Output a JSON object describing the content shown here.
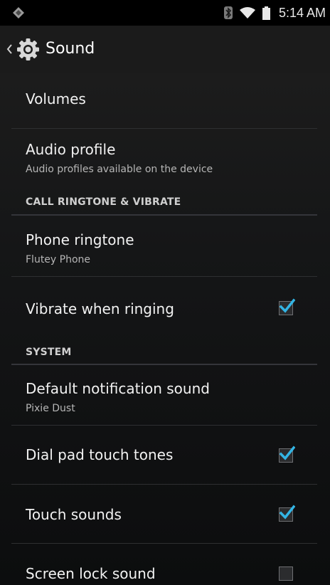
{
  "status_bar": {
    "time": "5:14 AM",
    "icons": [
      "app-notification-icon",
      "bluetooth-icon",
      "wifi-icon",
      "battery-icon"
    ]
  },
  "action_bar": {
    "title": "Sound",
    "icons": [
      "chevron-left-icon",
      "settings-gear-icon"
    ]
  },
  "items": {
    "volumes": {
      "title": "Volumes"
    },
    "audio_profile": {
      "title": "Audio profile",
      "summary": "Audio profiles available on the device"
    },
    "phone_ringtone": {
      "title": "Phone ringtone",
      "summary": "Flutey Phone"
    },
    "vibrate_when_ringing": {
      "title": "Vibrate when ringing",
      "checked": true
    },
    "default_notification_sound": {
      "title": "Default notification sound",
      "summary": "Pixie Dust"
    },
    "dial_pad_touch_tones": {
      "title": "Dial pad touch tones",
      "checked": true
    },
    "touch_sounds": {
      "title": "Touch sounds",
      "checked": true
    },
    "screen_lock_sound": {
      "title": "Screen lock sound",
      "checked": false
    }
  },
  "sections": {
    "call": "CALL RINGTONE & VIBRATE",
    "system": "SYSTEM"
  },
  "colors": {
    "accent": "#33b5e5",
    "background": "#0b0b0b",
    "action_bar": "#1b1b1b"
  }
}
